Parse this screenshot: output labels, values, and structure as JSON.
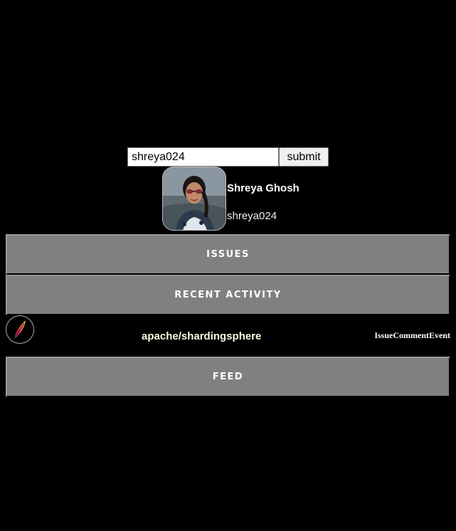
{
  "search": {
    "value": "shreya024",
    "submit_label": "submit"
  },
  "profile": {
    "name": "Shreya Ghosh",
    "login": "shreya024"
  },
  "buttons": {
    "issues": "ISSUES",
    "recent_activity": "RECENT ACTIVITY",
    "feed": "FEED"
  },
  "activity": {
    "repo": "apache/shardingsphere",
    "event_type": "IssueCommentEvent",
    "repo_icon": "feather-icon"
  },
  "colors": {
    "background": "#000000",
    "button_gray": "#808080",
    "text": "#ffffff"
  }
}
